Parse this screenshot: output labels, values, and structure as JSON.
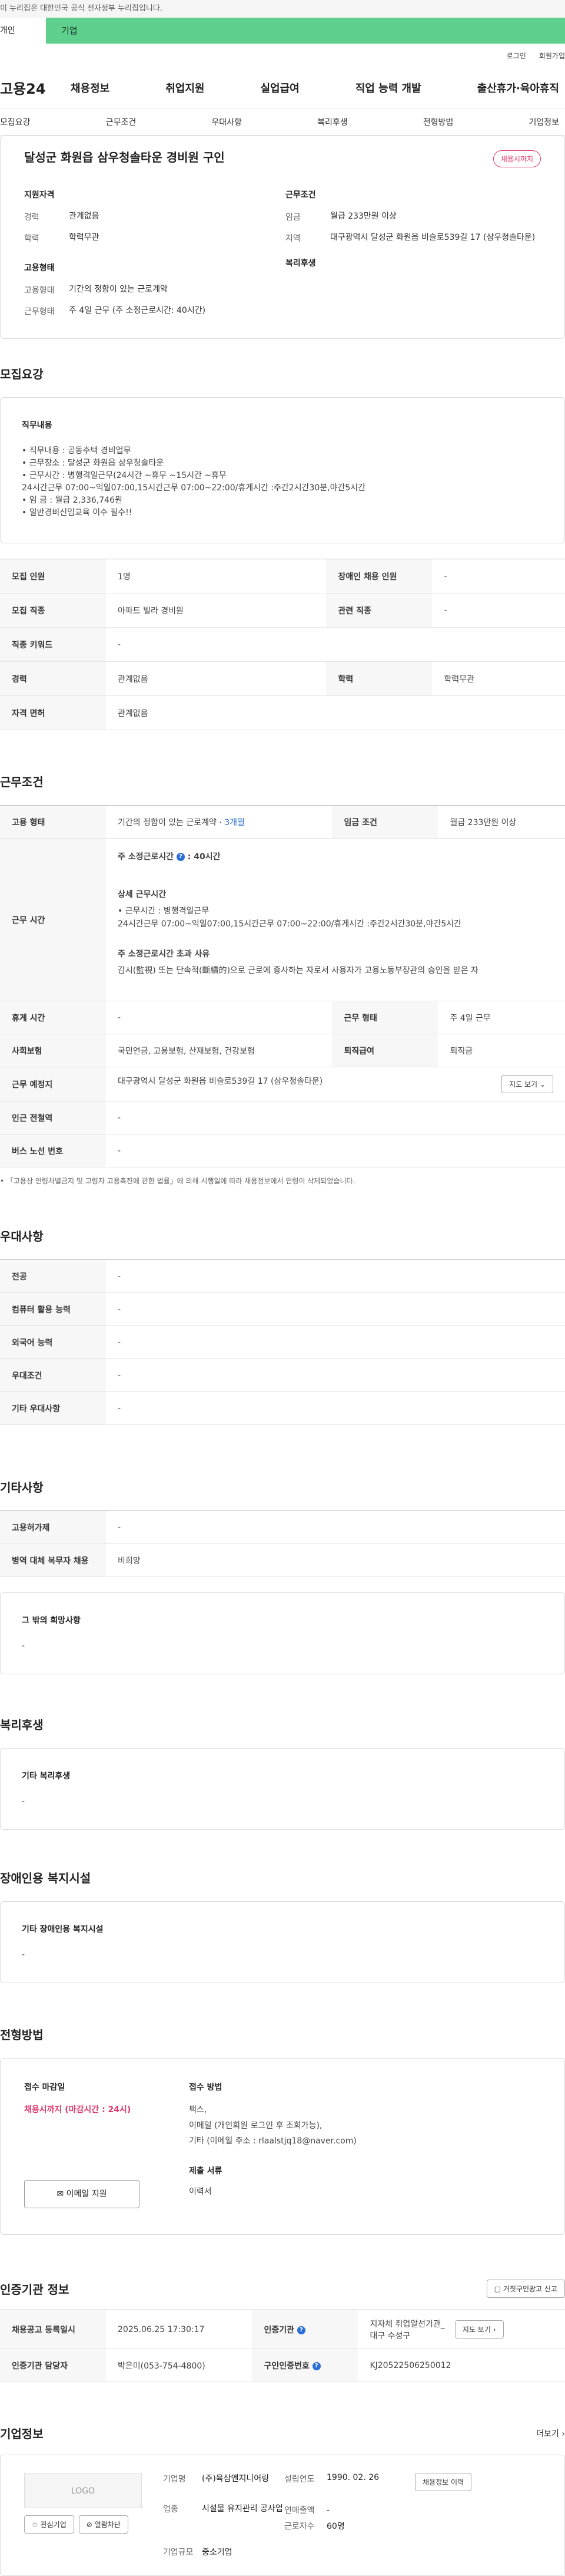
{
  "gov_banner": "이 누리집은 대한민국 공식 전자정부 누리집입니다.",
  "tabs": {
    "individual": "개인",
    "business": "기업"
  },
  "utility": {
    "login": "로그인",
    "signup": "회원가입"
  },
  "gnb": {
    "logo": "고용24",
    "menu": [
      "채용정보",
      "취업지원",
      "실업급여",
      "직업 능력 개발",
      "출산휴가·육아휴직"
    ]
  },
  "lnb": [
    "모집요강",
    "근무조건",
    "우대사항",
    "복리후생",
    "전형방법",
    "기업정보"
  ],
  "summary": {
    "title": "달성군 화원읍 삼우청솔타운 경비원 구인",
    "badge": "채용시까지",
    "qual_h": "지원자격",
    "career_k": "경력",
    "career_v": "관계없음",
    "edu_k": "학력",
    "edu_v": "학력무관",
    "employ_h": "고용형태",
    "etype_k": "고용형태",
    "etype_v": "기간의 정함이 있는 근로계약",
    "work_k": "근무형태",
    "work_v": "주 4일 근무 (주 소정근로시간: 40시간)",
    "cond_h": "근무조건",
    "wage_k": "임금",
    "wage_v": "월급 233만원 이상",
    "area_k": "지역",
    "area_v": "대구광역시 달성군 화원읍 비슬로539길 17 (삼우청솔타운)",
    "welfare_h": "복리후생"
  },
  "recruit": {
    "title": "모집요강",
    "job_h": "직무내용",
    "job_text": "• 직무내용 : 공동주택 경비업무\n• 근무장소 : 달성군 화원읍 삼우청솔타운\n• 근무시간 : 병행격일근무(24시간 ~휴무 ~15시간 ~휴무\n   24시간근무 07:00~익일07:00,15시간근무 07:00~22:00/휴게시간 :주간2시간30분,야간5시간\n• 임      금 : 월급 2,336,746원\n• 일반경비신임교육 이수 필수!!",
    "rows": [
      {
        "k": "모집 인원",
        "v": "1명",
        "k2": "장애인 채용 인원",
        "v2": "-"
      },
      {
        "k": "모집 직종",
        "v": "아파트 빌라 경비원",
        "k2": "관련 직종",
        "v2": "-"
      },
      {
        "k": "직종 키워드",
        "v": "-"
      },
      {
        "k": "경력",
        "v": "관계없음",
        "k2": "학력",
        "v2": "학력무관"
      },
      {
        "k": "자격 면허",
        "v": "관계없음"
      }
    ]
  },
  "work": {
    "title": "근무조건",
    "etype_k": "고용 형태",
    "etype_v": "기간의 정함이 있는 근로계약 ·",
    "etype_link": "3개월",
    "wage_k": "임금 조건",
    "wage_v": "월급 233만원 이상",
    "hours_k": "근무 시간",
    "hours_h1": "주 소정근로시간",
    "hours_v1": ": 40시간",
    "hours_h2": "상세 근무시간",
    "hours_t2": "• 근무시간 : 병행격일근무\n     24시간근무 07:00~익일07:00,15시간근무 07:00~22:00/휴게시간 :주간2시간30분,야간5시간",
    "hours_h3": "주 소정근로시간 초과 사유",
    "hours_t3": "감시(監視) 또는 단속적(斷續的)으로 근로에 종사하는 자로서 사용자가 고용노동부장관의 승인을 받은 자",
    "rows": [
      {
        "k": "휴게 시간",
        "v": "-",
        "k2": "근무 형태",
        "v2": "주 4일 근무"
      },
      {
        "k": "사회보험",
        "v": "국민연금, 고용보험, 산재보험, 건강보험",
        "k2": "퇴직급여",
        "v2": "퇴직금"
      }
    ],
    "loc_k": "근무 예정지",
    "loc_v": "대구광역시 달성군 화원읍 비슬로539길 17 (삼우청솔타운)",
    "map_btn": "지도 보기",
    "subway_k": "인근 전철역",
    "subway_v": "-",
    "bus_k": "버스 노선 번호",
    "bus_v": "-",
    "note": "• 「고용상 연령차별금지 및 고령자 고용촉진에 관한 법률」에 의해 시행일에 따라 채용정보에서 연령이 삭제되었습니다."
  },
  "pref": {
    "title": "우대사항",
    "rows": [
      {
        "k": "전공",
        "v": "-"
      },
      {
        "k": "컴퓨터 활용 능력",
        "v": "-"
      },
      {
        "k": "외국어 능력",
        "v": "-"
      },
      {
        "k": "우대조건",
        "v": "-"
      },
      {
        "k": "기타 우대사항",
        "v": "-"
      }
    ]
  },
  "etc": {
    "title": "기타사항",
    "rows": [
      {
        "k": "고용허가제",
        "v": "-"
      },
      {
        "k": "병역 대체 복무자 채용",
        "v": "비희망"
      }
    ],
    "hope_h": "그 밖의 희망사항",
    "hope_v": "-"
  },
  "welfare": {
    "title": "복리후생",
    "h": "기타 복리후생",
    "v": "-"
  },
  "disabled": {
    "title": "장애인용 복지시설",
    "h": "기타 장애인용 복지시설",
    "v": "-"
  },
  "screen": {
    "title": "전형방법",
    "deadline_h": "접수 마감일",
    "deadline_v": "채용시까지 (마감시간 : 24시)",
    "email_btn": "이메일 지원",
    "method_h": "접수 방법",
    "method_v": "팩스,\n이메일 (개인회원 로그인 후 조회가능),\n기타 (이메일 주소 : rlaalstjq18@naver.com)",
    "docs_h": "제출 서류",
    "docs_v": "이력서"
  },
  "cert": {
    "title": "인증기관 정보",
    "report_btn": "거짓구인광고 신고",
    "reg_k": "채용공고 등록일시",
    "reg_v": "2025.06.25 17:30:17",
    "org_k": "인증기관",
    "org_v": "지자체 취업알선기관_대구 수성구",
    "map_btn": "지도 보기",
    "mgr_k": "인증기관 담당자",
    "mgr_v": "박은미(053-754-4800)",
    "id_k": "구인인증번호",
    "id_v": "KJ20522506250012"
  },
  "company": {
    "title": "기업정보",
    "more": "더보기",
    "logo": "LOGO",
    "fav_btn": "관심기업",
    "block_btn": "열람차단",
    "name_k": "기업명",
    "name_v": "(주)육삼엔지니어링",
    "found_k": "설립연도",
    "found_v": "1990. 02. 26",
    "list_btn": "채용정보 이력",
    "biz_k": "업종",
    "biz_v": "시설물 유지관리 공사업",
    "sales_k": "연매출액",
    "sales_v": "-",
    "emp_k": "근로자수",
    "emp_v": "60명",
    "size_k": "기업규모",
    "size_v": "중소기업"
  }
}
